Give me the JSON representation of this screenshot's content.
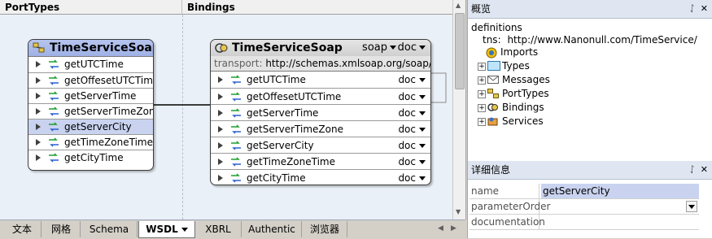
{
  "design": {
    "portTypes_header": "PortTypes",
    "bindings_header": "Bindings",
    "porttype_box": {
      "title": "TimeServiceSoap",
      "operations": [
        "getUTCTime",
        "getOffesetUTCTime",
        "getServerTime",
        "getServerTimeZone",
        "getServerCity",
        "getTimeZoneTime",
        "getCityTime"
      ],
      "selected_index": 4
    },
    "binding_box": {
      "title": "TimeServiceSoap",
      "protocol": "soap",
      "style": "doc",
      "transport_label": "transport:",
      "transport_value": "http://schemas.xmlsoap.org/soap/http",
      "operations": [
        "getUTCTime",
        "getOffesetUTCTime",
        "getServerTime",
        "getServerTimeZone",
        "getServerCity",
        "getTimeZoneTime",
        "getCityTime"
      ],
      "op_style": "doc"
    }
  },
  "overview": {
    "title": "概览",
    "root": "definitions",
    "tns_label": "tns:",
    "tns_value": "http://www.Nanonull.com/TimeService/",
    "items": [
      "Imports",
      "Types",
      "Messages",
      "PortTypes",
      "Bindings",
      "Services"
    ]
  },
  "details": {
    "title": "详细信息",
    "rows": [
      {
        "name": "name",
        "value": "getServerCity"
      },
      {
        "name": "parameterOrder",
        "value": ""
      },
      {
        "name": "documentation",
        "value": ""
      }
    ]
  },
  "tabs": [
    "文本",
    "网格",
    "Schema",
    "WSDL",
    "XBRL",
    "Authentic",
    "浏览器"
  ],
  "active_tab": "WSDL",
  "colors": {
    "selection": "#c9d3f0",
    "pane_header": "#dfe6f1",
    "canvas": "#eaf0f8"
  }
}
